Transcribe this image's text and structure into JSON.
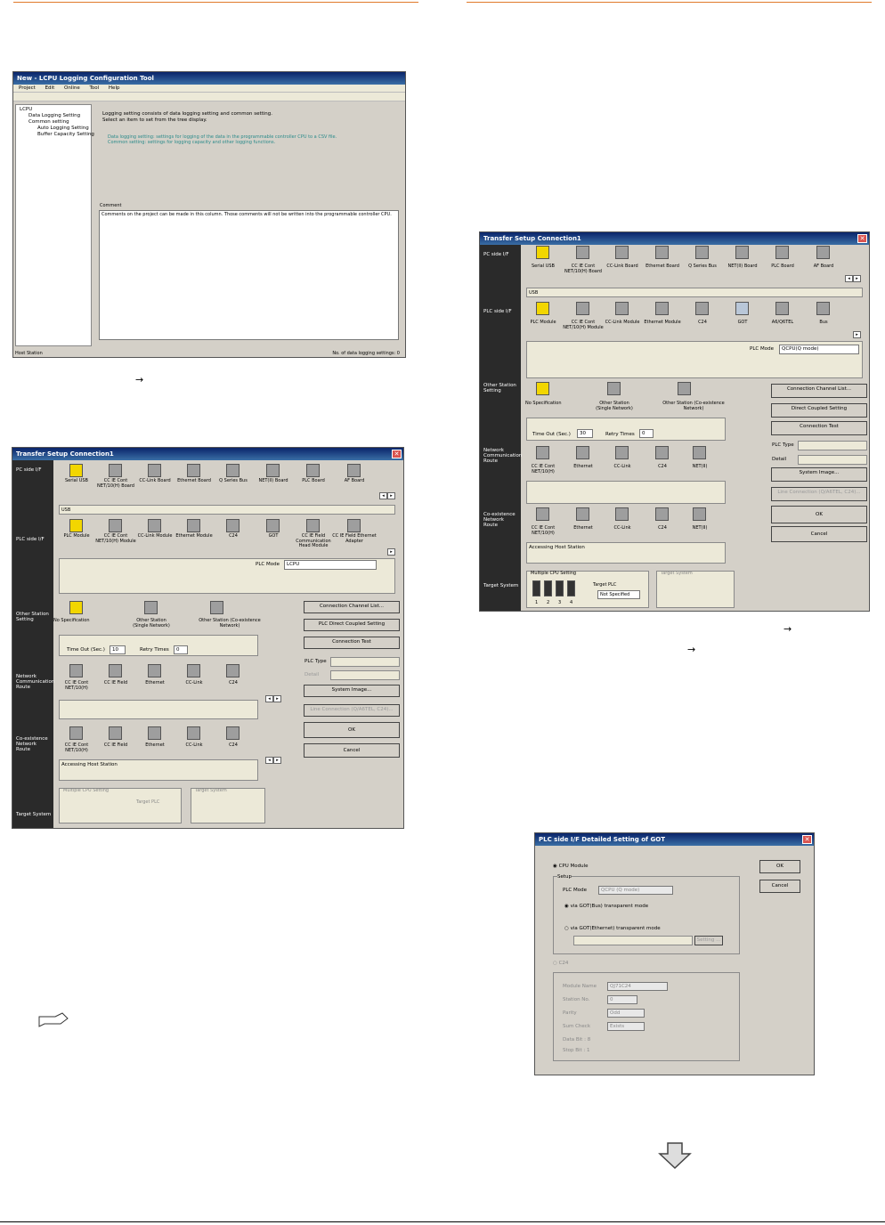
{
  "ptr_arrow": "→",
  "first": {
    "title": "New - LCPU Logging Configuration Tool",
    "menu": [
      "Project",
      "Edit",
      "Online",
      "Tool",
      "Help"
    ],
    "tree": [
      "LCPU",
      "Data Logging Setting",
      "Common setting",
      "Auto Logging Setting",
      "Buffer Capacity Setting"
    ],
    "lines": [
      "Logging setting consists of data logging setting and common setting.",
      "Select an item to set from the tree display."
    ],
    "desc": [
      "Data logging setting: settings for logging of the data in the programmable controller CPU to a CSV file.",
      "Common setting: settings for logging capacity and other logging functions."
    ],
    "comment_label": "Comment",
    "comment": "Comments on the project can be made in this column. Those comments will not be written into the programmable controller CPU.",
    "status_left": "Host Station",
    "status_right": "No. of data logging settings: 0"
  },
  "ts": {
    "title": "Transfer Setup Connection1",
    "sec": [
      "PC side I/F",
      "PLC side I/F",
      "Other Station Setting",
      "Network Communication Route",
      "Co-existence Network Route",
      "Target System"
    ],
    "timeout_label": "Time Out (Sec.)",
    "retry_label": "Retry Times",
    "plc_mode_label": "PLC Mode",
    "plc_type_label": "PLC Type",
    "detail_label": "Detail",
    "accessing": "Accessing Host Station",
    "multi_cpu": "Multiple CPU Setting",
    "target_plc": "Target PLC",
    "target_system": "Target System",
    "buttons": [
      "Connection Channel List...",
      "Direct Coupled Setting",
      "Connection Test",
      "System Image...",
      "Line Connection (Q/A6TEL, C24)...",
      "OK",
      "Cancel"
    ],
    "cpu_nums": [
      "1",
      "2",
      "3",
      "4"
    ]
  },
  "left": {
    "pc_if": [
      "Serial USB",
      "CC IE Cont NET/10(H) Board",
      "CC-Link Board",
      "Ethernet Board",
      "Q Series Bus",
      "NET(II) Board",
      "PLC Board",
      "AF Board"
    ],
    "pc_sel": "USB",
    "plc_if": [
      "PLC Module",
      "CC IE Cont NET/10(H) Module",
      "CC-Link Module",
      "Ethernet Module",
      "C24",
      "GOT",
      "CC IE Field Communication Head Module",
      "CC IE Field Ethernet Adapter"
    ],
    "plc_mode": "LCPU",
    "other": [
      "No Specification",
      "Other Station (Single Network)",
      "Other Station (Co-existence Network)"
    ],
    "timeout": "10",
    "retry": "0",
    "net": [
      "CC IE Cont NET/10(H)",
      "CC IE Field",
      "Ethernet",
      "CC-Link",
      "C24"
    ],
    "plc_direct": "PLC Direct Coupled Setting"
  },
  "right": {
    "pc_if": [
      "Serial USB",
      "CC IE Cont NET/10(H) Board",
      "CC-Link Board",
      "Ethernet Board",
      "Q Series Bus",
      "NET(II) Board",
      "PLC Board",
      "AF Board"
    ],
    "pc_sel": "USB",
    "plc_if": [
      "PLC Module",
      "CC IE Cont NET/10(H) Module",
      "CC-Link Module",
      "Ethernet Module",
      "C24",
      "GOT",
      "A6/Q6TEL",
      "Bus"
    ],
    "plc_mode": "QCPU(Q mode)",
    "other": [
      "No Specification",
      "Other Station (Single Network)",
      "Other Station (Co-existence Network)"
    ],
    "timeout": "30",
    "retry": "0",
    "net": [
      "CC IE Cont NET/10(H)",
      "Ethernet",
      "CC-Link",
      "C24",
      "NET(II)"
    ],
    "target_plc_val": "Not Specified"
  },
  "got": {
    "title": "PLC side I/F Detailed Setting of GOT",
    "cpu": "CPU Module",
    "setup": "Setup",
    "plc_mode_label": "PLC Mode",
    "plc_mode": "QCPU (Q mode)",
    "bus": "via GOT(Bus) transparent mode",
    "eth": "via GOT(Ethernet) transparent mode",
    "setting": "Setting ...",
    "c24": "C24",
    "module_name_label": "Module Name",
    "module_name": "QJ71C24",
    "station_label": "Station No.",
    "station": "0",
    "parity_label": "Parity",
    "parity": "Odd",
    "sum_label": "Sum Check",
    "sum": "Exists",
    "data_bit": "Data Bit : 8",
    "stop_bit": "Stop Bit : 1",
    "ok": "OK",
    "cancel": "Cancel"
  }
}
